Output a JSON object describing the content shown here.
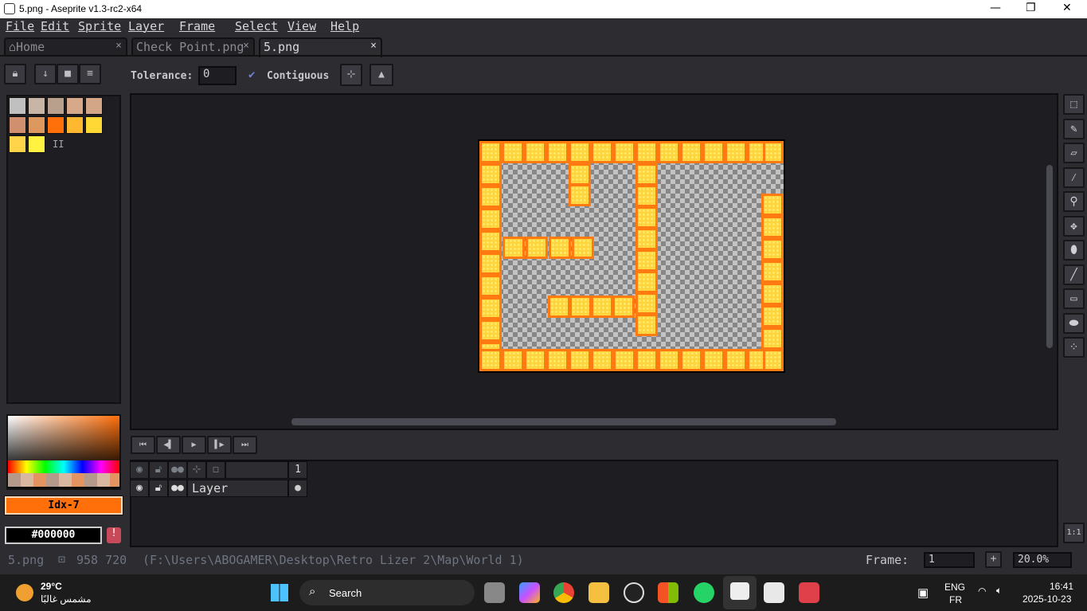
{
  "window": {
    "title": "5.png - Aseprite v1.3-rc2-x64",
    "minimize": "—",
    "maximize": "❐",
    "close": "✕"
  },
  "menu": [
    "File",
    "Edit",
    "Sprite",
    "Layer",
    "Frame",
    "Select",
    "View",
    "Help"
  ],
  "tabs": [
    {
      "label": "Home",
      "icon": "home-icon"
    },
    {
      "label": "Check  Point.png"
    },
    {
      "label": "5.png"
    }
  ],
  "tab_close": "×",
  "toolbar": {
    "tolerance_label": "Tolerance:",
    "tolerance_value": "0",
    "contiguous_label": "Contiguous",
    "contiguous_checked": true
  },
  "palette": {
    "colors": [
      "#c0c0c0",
      "#c9b5a5",
      "#b8a08d",
      "#d7a98a",
      "#d3a688",
      "#d09070",
      "#dd9860",
      "#ff6f0a",
      "#ffb830",
      "#ffd836",
      "#ffd44a",
      "#fff240"
    ],
    "extra": "II"
  },
  "color": {
    "index_label": "Idx-7",
    "index_color": "#ff6f0a",
    "hex": "#000000"
  },
  "animation_buttons": [
    "⏮",
    "◀▌",
    "▶",
    "▌▶",
    "⏭"
  ],
  "timeline": {
    "frame_number": "1",
    "layer_name": "Layer"
  },
  "status": {
    "filename": "5.png",
    "size": "958 720",
    "path": "(F:\\Users\\ABOGAMER\\Desktop\\Retro Lizer 2\\Map\\World 1)",
    "frame_label": "Frame:",
    "frame_value": "1",
    "add": "+",
    "zoom": "20.0%"
  },
  "right_tools": [
    "selection",
    "pencil",
    "eraser",
    "eyedropper",
    "zoom",
    "move",
    "paint-bucket",
    "line",
    "rectangle",
    "blur",
    "spray"
  ],
  "zoom_reset": "1:1",
  "taskbar": {
    "weather_temp": "29°C",
    "weather_desc": "مشمس غالبًا",
    "search": "Search",
    "lang1": "ENG",
    "lang2": "FR",
    "time": "16:41",
    "date": "2025-10-23"
  }
}
